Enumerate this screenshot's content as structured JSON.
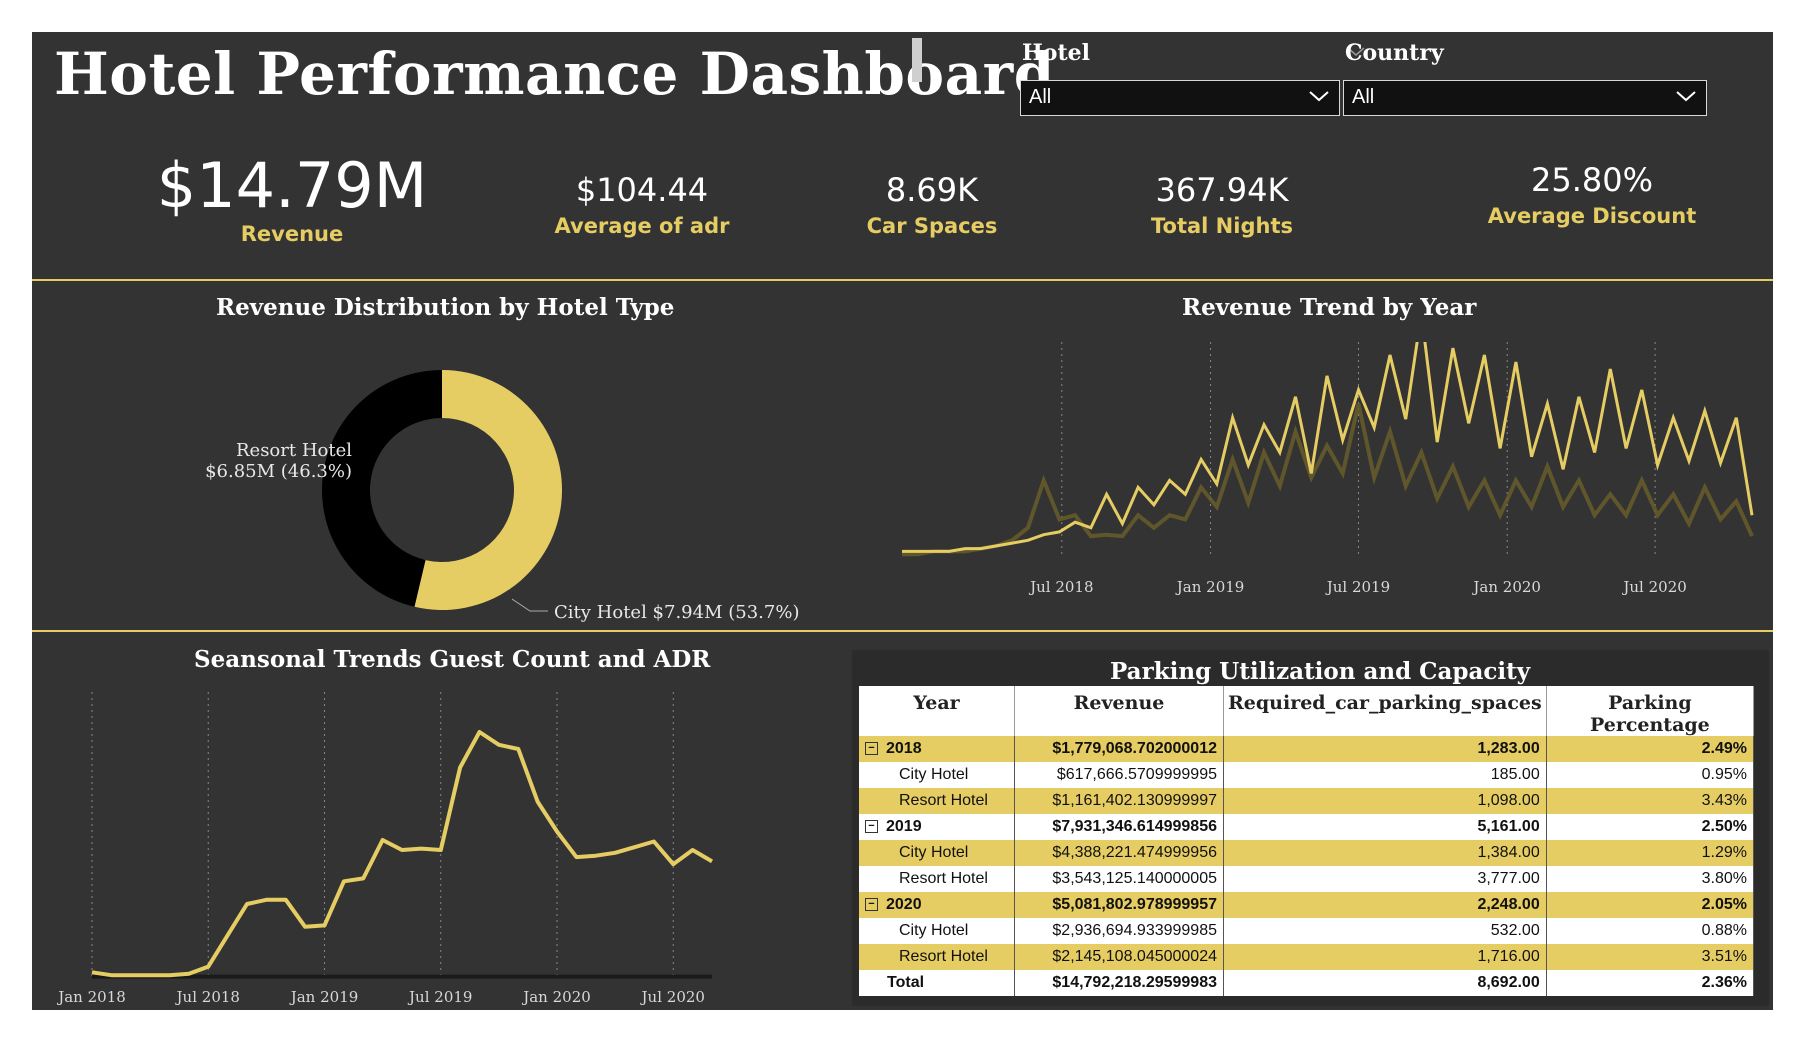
{
  "header": {
    "title": "Hotel Performance Dashboard"
  },
  "filters": {
    "hotel": {
      "label": "Hotel",
      "value": "All"
    },
    "country": {
      "label": "Country",
      "value": "All"
    }
  },
  "kpis": {
    "revenue": {
      "value": "$14.79M",
      "label": "Revenue"
    },
    "adr": {
      "value": "$104.44",
      "label": "Average of adr"
    },
    "car_spaces": {
      "value": "8.69K",
      "label": "Car Spaces"
    },
    "nights": {
      "value": "367.94K",
      "label": "Total Nights"
    },
    "discount": {
      "value": "25.80%",
      "label": "Average Discount"
    }
  },
  "colors": {
    "accent": "#e6cd63",
    "background": "#333333",
    "dark": "#000000"
  },
  "chart_data": [
    {
      "type": "pie",
      "title": "Revenue Distribution by Hotel Type",
      "slices": [
        {
          "name": "City Hotel",
          "value": 7.94,
          "percent": 53.7,
          "color": "#e6cd63"
        },
        {
          "name": "Resort Hotel",
          "value": 6.85,
          "percent": 46.3,
          "color": "#000000"
        }
      ],
      "labels": {
        "city": "City Hotel $7.94M (53.7%)",
        "resort_name": "Resort Hotel",
        "resort_value": "$6.85M (46.3%)"
      }
    },
    {
      "type": "line",
      "title": "Revenue Trend by Year",
      "xticks": [
        "Jul 2018",
        "Jan 2019",
        "Jul 2019",
        "Jan 2020",
        "Jul 2020"
      ],
      "x_start": "Jan 2018",
      "x_end": "Sep 2020",
      "series": [
        {
          "values": [
            2,
            2,
            2,
            2,
            3,
            3,
            4,
            5,
            6,
            8,
            12,
            10,
            14,
            18,
            16,
            20,
            25,
            22,
            30,
            28,
            35,
            40,
            44,
            38,
            50,
            46,
            40,
            52,
            56,
            48,
            62,
            58,
            66,
            70,
            55,
            60,
            64,
            58,
            52,
            56,
            48,
            44,
            42,
            46,
            50,
            54,
            52,
            48,
            44,
            40,
            46,
            42,
            45,
            40,
            20
          ]
        },
        {
          "values": [
            1,
            1,
            2,
            2,
            2,
            3,
            4,
            6,
            14,
            22,
            18,
            12,
            10,
            8,
            10,
            12,
            14,
            12,
            18,
            20,
            24,
            28,
            26,
            30,
            34,
            36,
            38,
            32,
            40,
            44,
            38,
            36,
            34,
            30,
            28,
            26,
            24,
            22,
            20,
            22,
            24,
            26,
            24,
            22,
            20,
            18,
            20,
            22,
            20,
            18,
            16,
            20,
            18,
            16,
            10
          ]
        }
      ]
    },
    {
      "type": "line",
      "title": "Seansonal Trends Guest Count and ADR",
      "xticks": [
        "Jan 2018",
        "Jul 2018",
        "Jan 2019",
        "Jul 2019",
        "Jan 2020",
        "Jul 2020"
      ],
      "x": [
        "2018-01",
        "2018-02",
        "2018-03",
        "2018-04",
        "2018-05",
        "2018-06",
        "2018-07",
        "2018-08",
        "2018-09",
        "2018-10",
        "2018-11",
        "2018-12",
        "2019-01",
        "2019-02",
        "2019-03",
        "2019-04",
        "2019-05",
        "2019-06",
        "2019-07",
        "2019-08",
        "2019-09",
        "2019-10",
        "2019-11",
        "2019-12",
        "2020-01",
        "2020-02",
        "2020-03",
        "2020-04",
        "2020-05",
        "2020-06",
        "2020-07",
        "2020-08",
        "2020-09"
      ],
      "series": [
        {
          "values": [
            4,
            2,
            2,
            2,
            2,
            3,
            8,
            30,
            52,
            55,
            55,
            36,
            37,
            68,
            70,
            97,
            90,
            91,
            90,
            148,
            173,
            164,
            161,
            124,
            103,
            85,
            86,
            88,
            92,
            96,
            80,
            90,
            82
          ]
        },
        {
          "values": [
            1,
            1,
            1,
            1,
            1,
            1,
            1,
            1,
            1,
            1,
            1,
            1,
            1,
            1,
            1,
            1,
            1,
            1,
            1,
            1,
            1,
            1,
            1,
            1,
            1,
            1,
            1,
            1,
            1,
            1,
            1,
            1,
            1
          ]
        }
      ]
    },
    {
      "type": "table",
      "title": "Parking Utilization and Capacity",
      "columns": [
        "Year",
        "Revenue",
        "Required_car_parking_spaces",
        "Parking Percentage"
      ],
      "rows": [
        {
          "label": "2018",
          "revenue": "$1,779,068.702000012",
          "spaces": "1,283.00",
          "pct": "2.49%"
        },
        {
          "label": "City Hotel",
          "revenue": "$617,666.5709999995",
          "spaces": "185.00",
          "pct": "0.95%"
        },
        {
          "label": "Resort Hotel",
          "revenue": "$1,161,402.130999997",
          "spaces": "1,098.00",
          "pct": "3.43%"
        },
        {
          "label": "2019",
          "revenue": "$7,931,346.614999856",
          "spaces": "5,161.00",
          "pct": "2.50%"
        },
        {
          "label": "City Hotel",
          "revenue": "$4,388,221.474999956",
          "spaces": "1,384.00",
          "pct": "1.29%"
        },
        {
          "label": "Resort Hotel",
          "revenue": "$3,543,125.140000005",
          "spaces": "3,777.00",
          "pct": "3.80%"
        },
        {
          "label": "2020",
          "revenue": "$5,081,802.978999957",
          "spaces": "2,248.00",
          "pct": "2.05%"
        },
        {
          "label": "City Hotel",
          "revenue": "$2,936,694.933999985",
          "spaces": "532.00",
          "pct": "0.88%"
        },
        {
          "label": "Resort Hotel",
          "revenue": "$2,145,108.045000024",
          "spaces": "1,716.00",
          "pct": "3.51%"
        },
        {
          "label": "Total",
          "revenue": "$14,792,218.29599983",
          "spaces": "8,692.00",
          "pct": "2.36%"
        }
      ]
    }
  ]
}
